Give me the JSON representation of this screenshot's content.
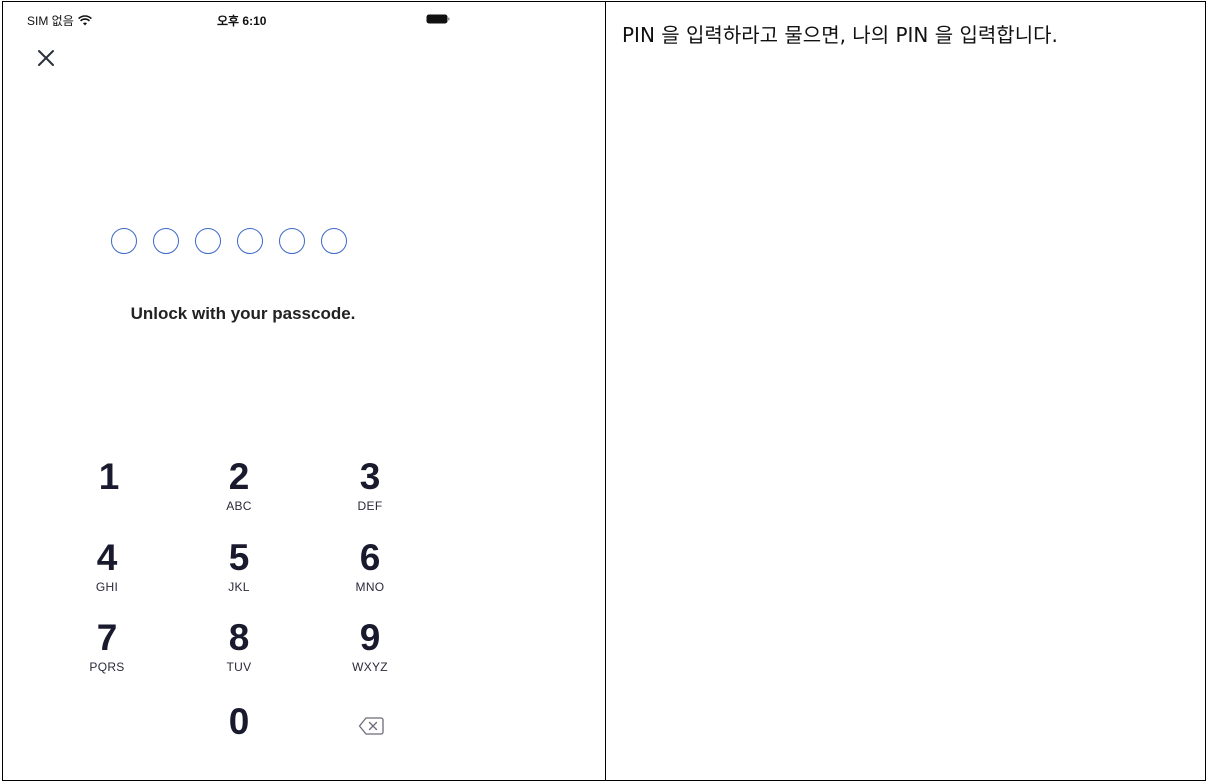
{
  "status_bar": {
    "carrier": "SIM 없음",
    "time": "오후 6:10"
  },
  "passcode": {
    "digit_count": 6,
    "entered": 0,
    "prompt": "Unlock with your passcode.",
    "accent_color": "#3d67c9"
  },
  "keypad": {
    "keys": [
      {
        "num": "1",
        "letters": ""
      },
      {
        "num": "2",
        "letters": "ABC"
      },
      {
        "num": "3",
        "letters": "DEF"
      },
      {
        "num": "4",
        "letters": "GHI"
      },
      {
        "num": "5",
        "letters": "JKL"
      },
      {
        "num": "6",
        "letters": "MNO"
      },
      {
        "num": "7",
        "letters": "PQRS"
      },
      {
        "num": "8",
        "letters": "TUV"
      },
      {
        "num": "9",
        "letters": "WXYZ"
      },
      {
        "num": "0",
        "letters": ""
      }
    ]
  },
  "instruction": {
    "text": "PIN 을 입력하라고 물으면, 나의 PIN 을 입력합니다."
  }
}
